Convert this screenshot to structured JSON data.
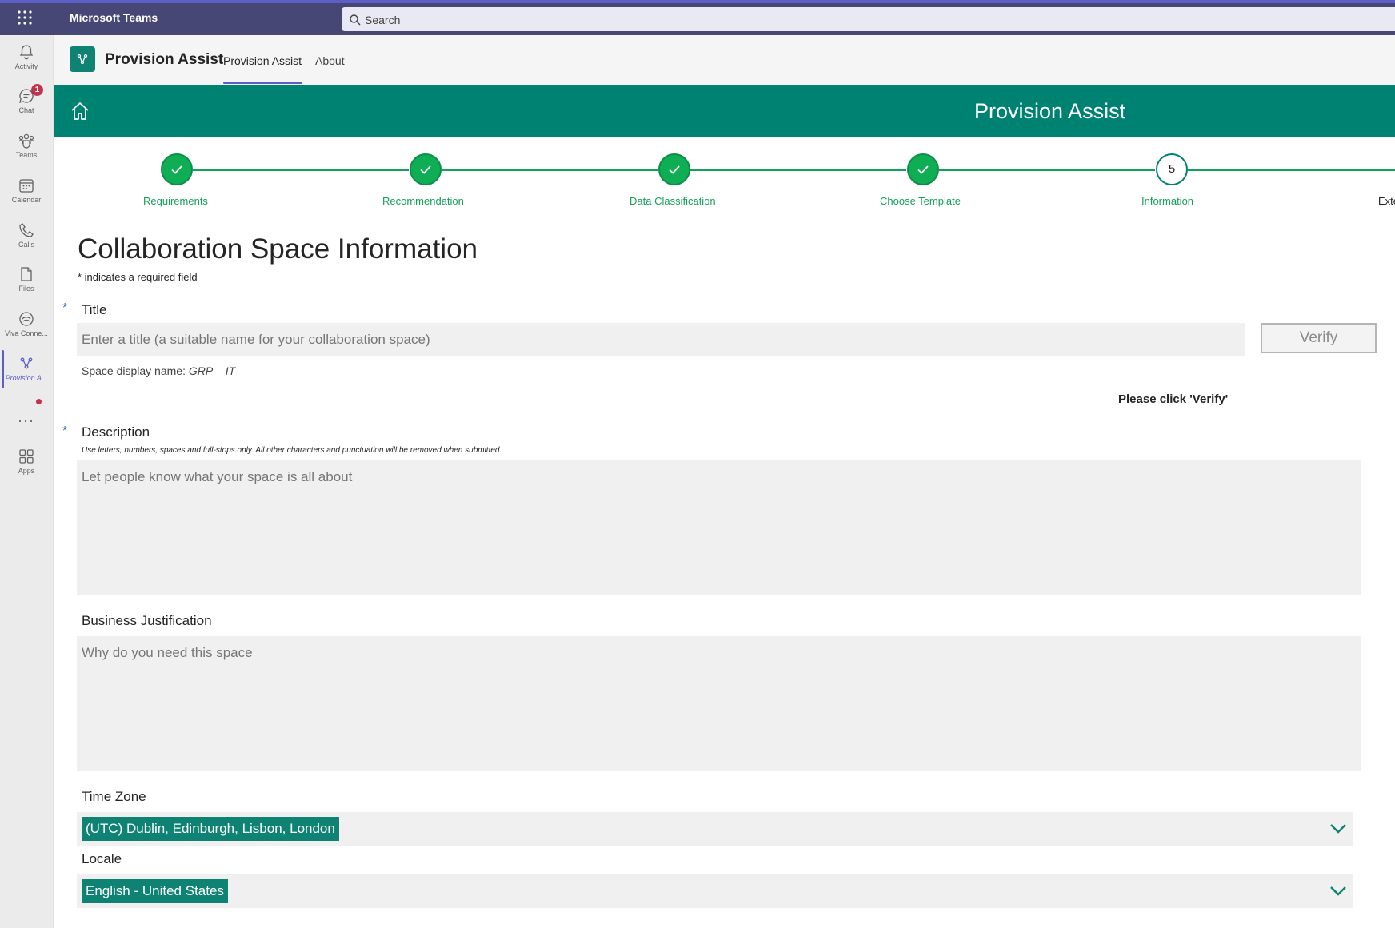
{
  "topbar": {
    "app_name": "Microsoft Teams",
    "search_placeholder": "Search"
  },
  "rail": {
    "items": [
      {
        "label": "Activity",
        "icon": "bell-icon"
      },
      {
        "label": "Chat",
        "icon": "chat-icon",
        "badge": "1"
      },
      {
        "label": "Teams",
        "icon": "teams-icon"
      },
      {
        "label": "Calendar",
        "icon": "calendar-icon"
      },
      {
        "label": "Calls",
        "icon": "phone-icon"
      },
      {
        "label": "Files",
        "icon": "file-icon"
      },
      {
        "label": "Viva Conne...",
        "icon": "viva-connections-icon"
      },
      {
        "label": "Provision A...",
        "icon": "provision-assist-icon"
      },
      {
        "label": "Apps",
        "icon": "apps-icon"
      }
    ],
    "more": "···"
  },
  "app_header": {
    "title": "Provision Assist",
    "tabs": [
      "Provision Assist",
      "About"
    ]
  },
  "banner": {
    "title": "Provision Assist"
  },
  "stepper": {
    "steps": [
      {
        "label": "Requirements",
        "status": "done"
      },
      {
        "label": "Recommendation",
        "status": "done"
      },
      {
        "label": "Data Classification",
        "status": "done"
      },
      {
        "label": "Choose Template",
        "status": "done"
      },
      {
        "label": "Information",
        "status": "current",
        "number": "5"
      },
      {
        "label": "Exte",
        "status": "upcoming"
      }
    ]
  },
  "form": {
    "title": "Collaboration Space Information",
    "required_note": "* indicates a required field",
    "asterisk": "*",
    "title_label": "Title",
    "title_placeholder": "Enter a title (a suitable name for your collaboration space)",
    "verify_label": "Verify",
    "display_name_label": "Space display name:",
    "display_name_value": "GRP__IT",
    "verify_message": "Please click 'Verify'",
    "description_label": "Description",
    "description_hint": "Use letters, numbers, spaces and full-stops only. All other characters and punctuation will be removed when submitted.",
    "description_placeholder": "Let people know what your space is all about",
    "justification_label": "Business Justification",
    "justification_placeholder": "Why do you need this space",
    "timezone_label": "Time Zone",
    "timezone_value": "(UTC) Dublin, Edinburgh, Lisbon, London",
    "locale_label": "Locale",
    "locale_value": "English - United States"
  },
  "colors": {
    "teams_purple": "#464775",
    "accent": "#5b5fc7",
    "banner_green": "#008272",
    "step_green": "#0fae55"
  }
}
